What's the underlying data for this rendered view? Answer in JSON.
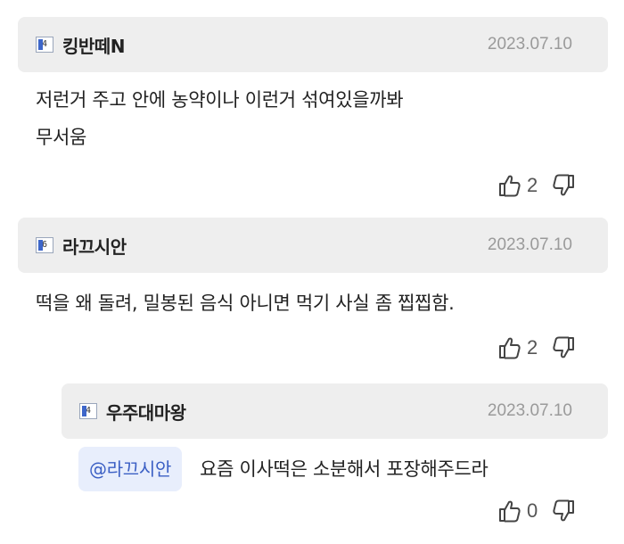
{
  "comments": [
    {
      "level": "4",
      "nickname": "킹반떼N",
      "date": "2023.07.10",
      "lines": [
        "저런거 주고 안에 농약이나 이런거 섞여있을까봐",
        "무서움"
      ],
      "likes": "2"
    },
    {
      "level": "6",
      "nickname": "라끄시안",
      "date": "2023.07.10",
      "lines": [
        "떡을 왜 돌려, 밀봉된 음식 아니면 먹기 사실 좀 찝찝함."
      ],
      "likes": "2"
    }
  ],
  "reply": {
    "level": "4",
    "nickname": "우주대마왕",
    "date": "2023.07.10",
    "mention": "@라끄시안",
    "text": "요즘 이사떡은 소분해서 포장해주드라",
    "likes": "0"
  },
  "icons": {
    "like": "thumbs-up-icon",
    "dislike": "thumbs-down-icon"
  }
}
